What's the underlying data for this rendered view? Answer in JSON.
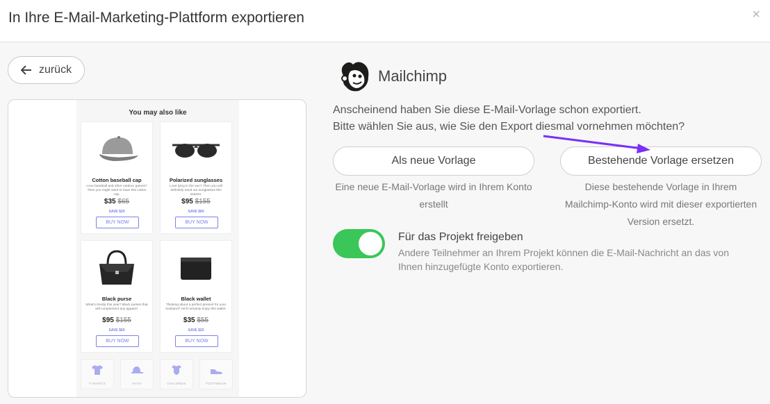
{
  "header": {
    "title": "In Ihre E-Mail-Marketing-Plattform exportieren",
    "close_label": "×"
  },
  "back": {
    "label": "zurück"
  },
  "preview": {
    "heading": "You may also like",
    "products": [
      {
        "name": "Cotton baseball cap",
        "desc": "Love baseball and other outdoor games? Then you might want to have this cotton cap.",
        "price": "$35",
        "old_price": "$65",
        "save": "SAVE $20",
        "button": "BUY NOW",
        "icon": "cap-image"
      },
      {
        "name": "Polarized sunglasses",
        "desc": "Love lying in the sun? Then you will definitely need our sunglasses this season.",
        "price": "$95",
        "old_price": "$155",
        "save": "SAVE $60",
        "button": "BUY NOW",
        "icon": "sunglasses-image"
      },
      {
        "name": "Black purse",
        "desc": "What's trendy this year? Black purses that will complement any apparel.",
        "price": "$95",
        "old_price": "$155",
        "save": "SAVE $60",
        "button": "BUY NOW",
        "icon": "purse-image"
      },
      {
        "name": "Black wallet",
        "desc": "Thinking about a perfect present for your husband? He'll certainly enjoy this wallet.",
        "price": "$35",
        "old_price": "$55",
        "save": "SAVE $20",
        "button": "BUY NOW",
        "icon": "wallet-image"
      }
    ],
    "categories": [
      "T-SHIRTS",
      "HATS",
      "CHILDREN",
      "FOOTWEAR"
    ]
  },
  "provider": {
    "name": "Mailchimp",
    "icon": "mailchimp-logo"
  },
  "message": {
    "line1": "Anscheinend haben Sie diese E-Mail-Vorlage schon exportiert.",
    "line2": "Bitte wählen Sie aus, wie Sie den Export diesmal vornehmen möchten?"
  },
  "options": {
    "new": {
      "label": "Als neue Vorlage",
      "desc": "Eine neue E-Mail-Vorlage wird in Ihrem Konto erstellt"
    },
    "replace": {
      "label": "Bestehende Vorlage ersetzen",
      "desc": "Diese bestehende Vorlage in Ihrem Mailchimp-Konto wird mit dieser exportierten Version ersetzt."
    }
  },
  "share": {
    "enabled": true,
    "title": "Für das Projekt freigeben",
    "desc": "Andere Teilnehmer an Ihrem Projekt können die E-Mail-Nachricht an das von Ihnen hinzugefügte Konto exportieren."
  },
  "colors": {
    "toggle_on": "#3ac659",
    "accent_purple": "#7b2ff7",
    "preview_link": "#7b82e6"
  }
}
